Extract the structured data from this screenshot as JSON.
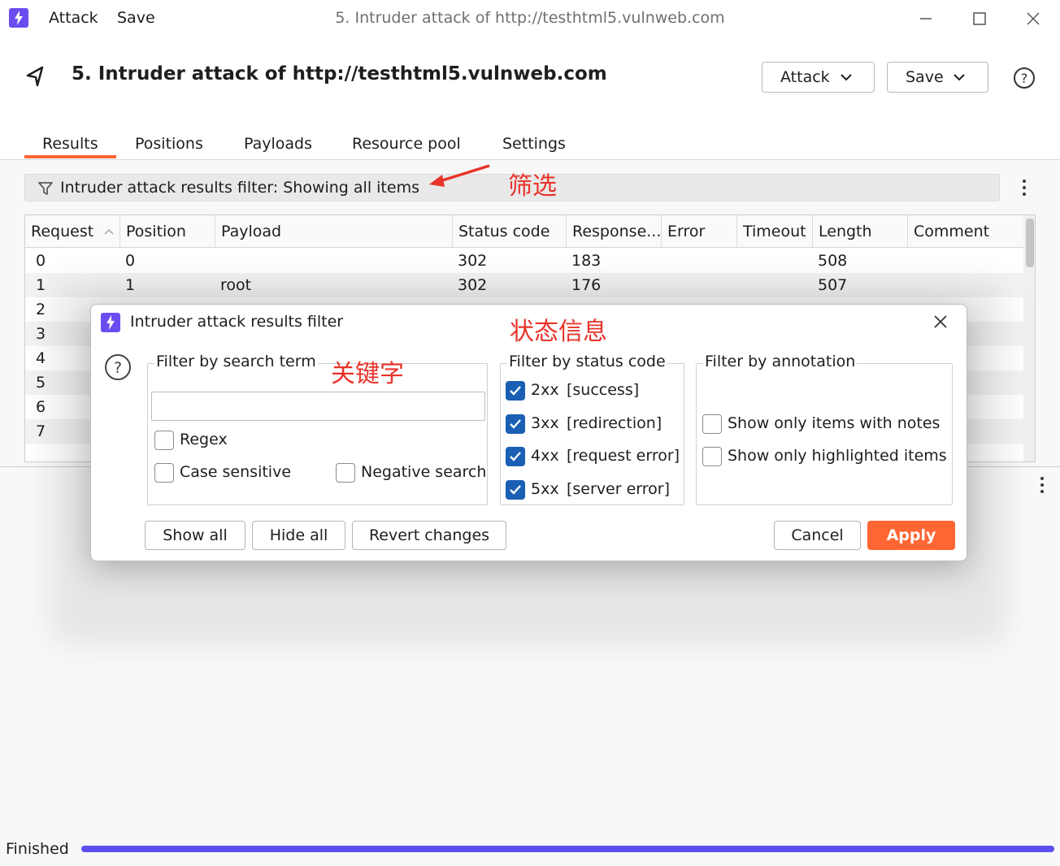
{
  "window": {
    "menu": [
      "Attack",
      "Save"
    ],
    "title": "5. Intruder attack of http://testhtml5.vulnweb.com"
  },
  "header": {
    "title": "5. Intruder attack of http://testhtml5.vulnweb.com",
    "attack_label": "Attack",
    "save_label": "Save"
  },
  "tabs": [
    "Results",
    "Positions",
    "Payloads",
    "Resource pool",
    "Settings"
  ],
  "active_tab": "Results",
  "filter_bar": {
    "text": "Intruder attack results filter: Showing all items"
  },
  "annotations": {
    "filter": "筛选",
    "status_info": "状态信息",
    "keyword": "关键字"
  },
  "table": {
    "columns": [
      "Request",
      "Position",
      "Payload",
      "Status code",
      "Response...",
      "Error",
      "Timeout",
      "Length",
      "Comment"
    ],
    "rows": [
      {
        "request": "0",
        "position": "0",
        "payload": "",
        "status": "302",
        "response": "183",
        "length": "508"
      },
      {
        "request": "1",
        "position": "1",
        "payload": "root",
        "status": "302",
        "response": "176",
        "length": "507"
      },
      {
        "request": "2"
      },
      {
        "request": "3"
      },
      {
        "request": "4"
      },
      {
        "request": "5"
      },
      {
        "request": "6"
      },
      {
        "request": "7"
      }
    ]
  },
  "dialog": {
    "title": "Intruder attack results filter",
    "search": {
      "legend": "Filter by search term",
      "value": "",
      "regex": {
        "label": "Regex",
        "checked": false
      },
      "case_sensitive": {
        "label": "Case sensitive",
        "checked": false
      },
      "negative": {
        "label": "Negative search",
        "checked": false
      }
    },
    "status": {
      "legend": "Filter by status code",
      "codes": [
        {
          "code": "2xx",
          "desc": "[success]",
          "checked": true
        },
        {
          "code": "3xx",
          "desc": "[redirection]",
          "checked": true
        },
        {
          "code": "4xx",
          "desc": "[request error]",
          "checked": true
        },
        {
          "code": "5xx",
          "desc": "[server error]",
          "checked": true
        }
      ]
    },
    "annotation": {
      "legend": "Filter by annotation",
      "notes": {
        "label": "Show only items with notes",
        "checked": false
      },
      "highlighted": {
        "label": "Show only highlighted items",
        "checked": false
      }
    },
    "buttons": {
      "show_all": "Show all",
      "hide_all": "Hide all",
      "revert": "Revert changes",
      "cancel": "Cancel",
      "apply": "Apply"
    }
  },
  "status_bar": {
    "text": "Finished",
    "progress": 1.0
  },
  "colors": {
    "accent": "#ff6633",
    "brand": "#6a4cf0",
    "checkbox": "#1a5fb4",
    "annotation": "#e8332a",
    "progress": "#5b4ff0"
  }
}
